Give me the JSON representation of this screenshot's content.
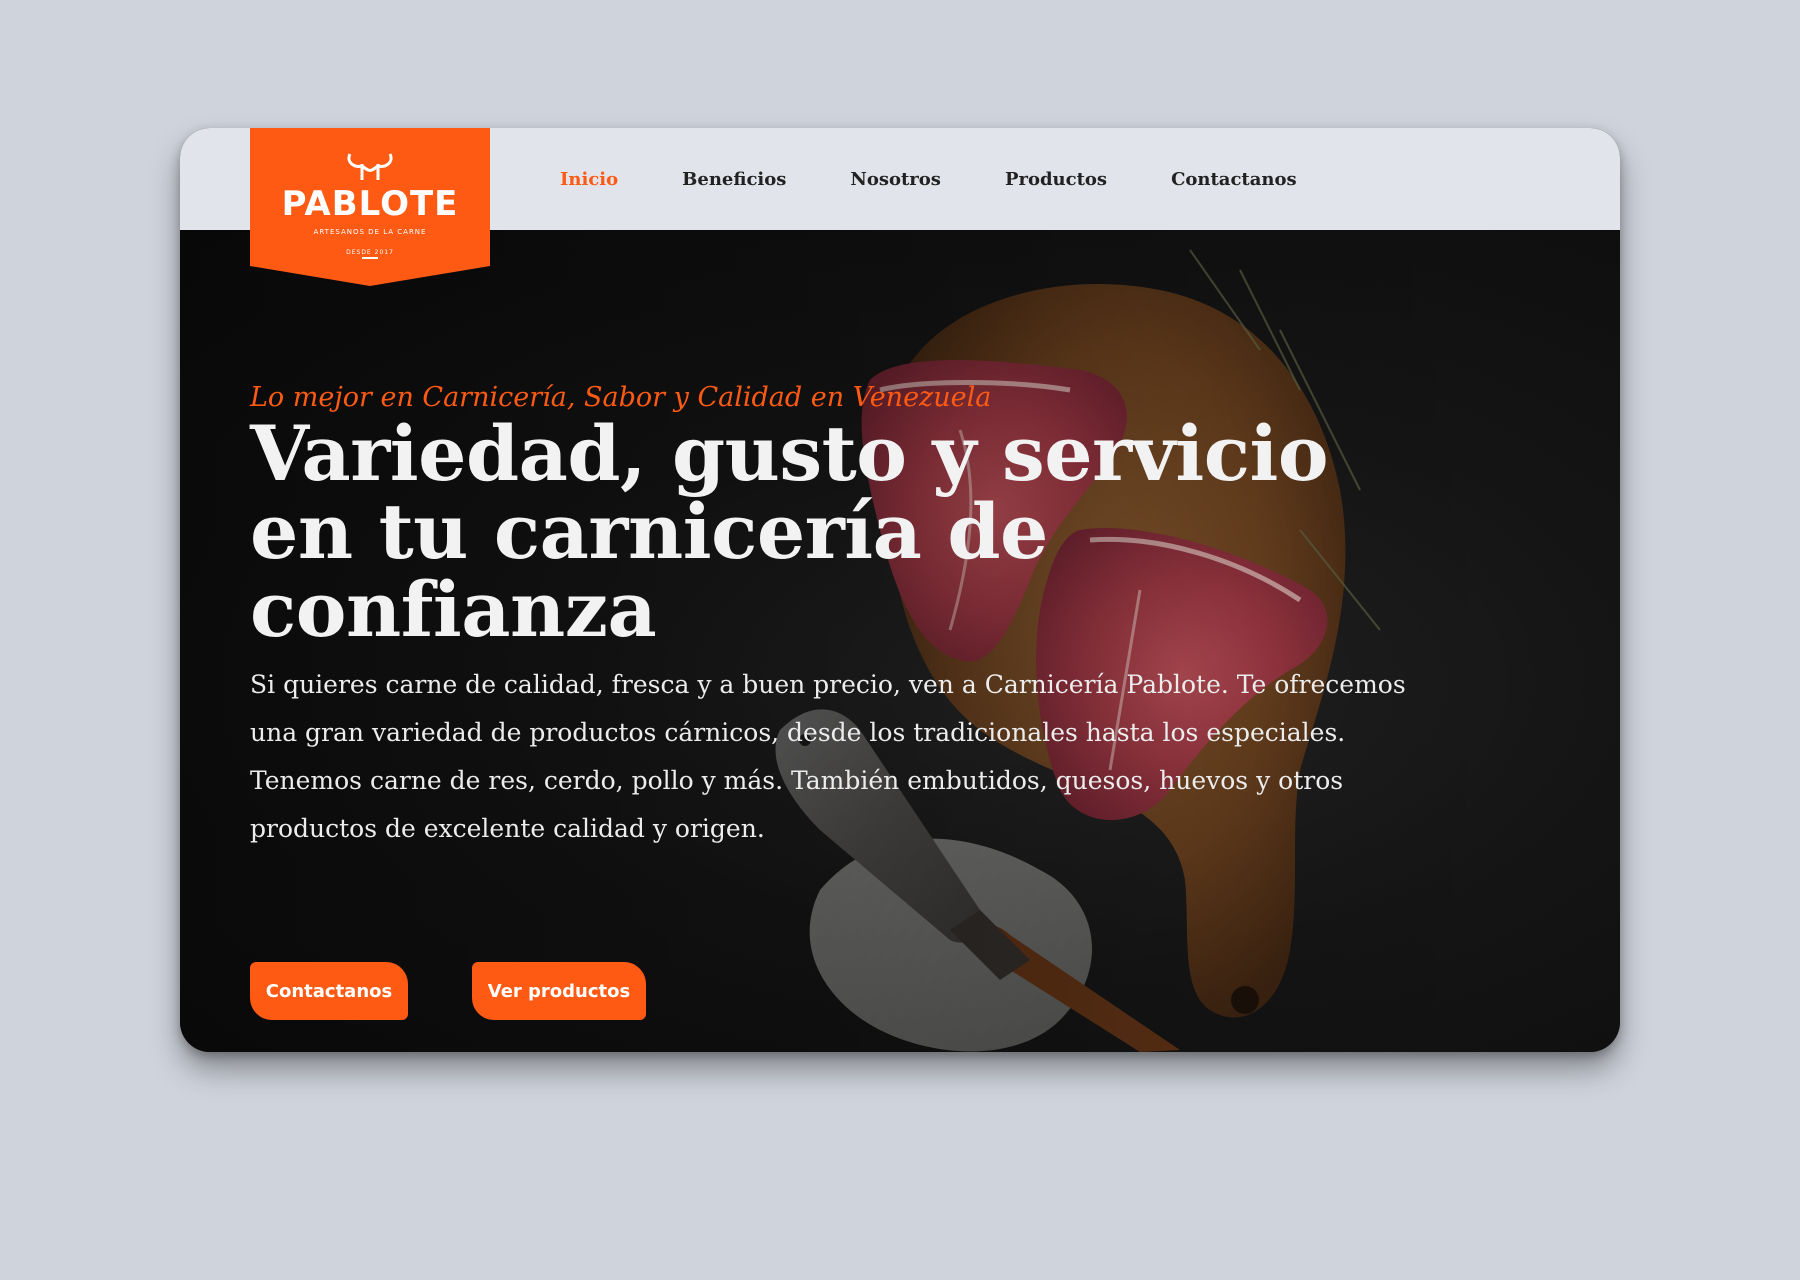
{
  "brand": {
    "name": "PABLOTE",
    "slogan": "ARTESANOS DE LA CARNE",
    "since": "DESDE 2017",
    "accent_color": "#ff5a14"
  },
  "nav": {
    "items": [
      {
        "label": "Inicio",
        "active": true
      },
      {
        "label": "Beneficios",
        "active": false
      },
      {
        "label": "Nosotros",
        "active": false
      },
      {
        "label": "Productos",
        "active": false
      },
      {
        "label": "Contactanos",
        "active": false
      }
    ]
  },
  "hero": {
    "tagline": "Lo mejor en Carnicería, Sabor y Calidad en Venezuela",
    "headline": "Variedad, gusto y servicio en tu carnicería de confianza",
    "description": "Si quieres carne de calidad, fresca y a buen precio, ven a Carnicería Pablote. Te ofrecemos una gran variedad de productos cárnicos, desde los tradicionales hasta los especiales. Tenemos carne de res, cerdo, pollo y más. También embutidos, quesos, huevos y otros productos de excelente calidad y origen.",
    "buttons": {
      "contact": "Contactanos",
      "products": "Ver productos"
    }
  }
}
